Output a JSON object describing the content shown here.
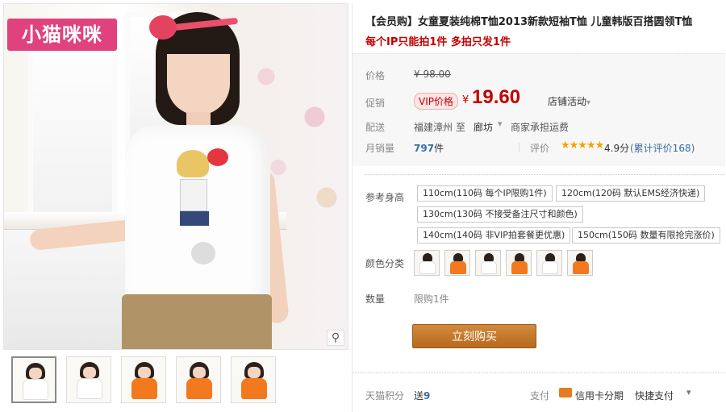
{
  "product": {
    "title": "【会员购】女童夏装纯棉T恤2013新款短袖T恤 儿童韩版百搭圆领T恤",
    "subtitle": "每个IP只能拍1件 多拍只发1件",
    "brand_logo_text": "小猫咪咪"
  },
  "price": {
    "original_label": "价格",
    "original_value": "¥ 98.00",
    "promo_label": "促销",
    "vip_badge": "VIP价格",
    "currency": "¥",
    "value": "19.60",
    "store_promo": "店铺活动",
    "store_promo_caret": "▾"
  },
  "shipping": {
    "label": "配送",
    "from": "福建漳州",
    "to_label": "至",
    "to": "廊坊",
    "caret": "▾",
    "note": "商家承担运费"
  },
  "sales": {
    "label": "月销量",
    "count": "797",
    "unit": "件",
    "review_label": "评价",
    "stars": "★★★★★",
    "score": "4.9分",
    "review_count": "(累计评价168)"
  },
  "options": {
    "size_label": "参考身高",
    "sizes": [
      "110cm(110码 每个IP限购1件)",
      "120cm(120码 默认EMS经济快递)",
      "130cm(130码 不接受备注尺寸和颜色)",
      "140cm(140码 非VIP拍套餐更优惠)",
      "150cm(150码 数量有限抢完涨价)"
    ],
    "color_label": "颜色分类",
    "colors": [
      "#ffffff",
      "#f2791e",
      "#ffffff",
      "#f2791e",
      "#ffffff",
      "#f2791e"
    ],
    "qty_label": "数量",
    "qty_value": "限购1件"
  },
  "buy_button": "立刻购买",
  "footer": {
    "points_label": "天猫积分",
    "points_prefix": "送",
    "points": "9",
    "pay_label": "支付",
    "card": "信用卡分期",
    "fast": "快捷支付",
    "caret": "▾"
  },
  "thumbnails": [
    "#ffffff",
    "#ffffff",
    "#f2791e",
    "#f2791e",
    "#f2791e"
  ],
  "zoom_icon": "⚲"
}
